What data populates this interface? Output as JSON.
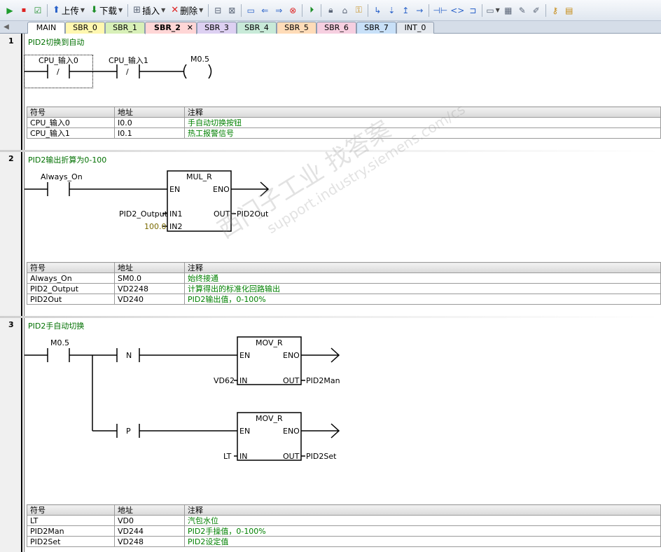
{
  "toolbar": {
    "upload_label": "上传",
    "download_label": "下载",
    "insert_label": "插入",
    "delete_label": "删除"
  },
  "tabs": [
    {
      "label": "MAIN",
      "color": "#ffffff",
      "active": false
    },
    {
      "label": "SBR_0",
      "color": "#fff7b0",
      "active": false
    },
    {
      "label": "SBR_1",
      "color": "#d8f0b8",
      "active": false
    },
    {
      "label": "SBR_2",
      "color": "#ffd6d6",
      "active": true
    },
    {
      "label": "SBR_3",
      "color": "#ddd0f2",
      "active": false
    },
    {
      "label": "SBR_4",
      "color": "#c8ead8",
      "active": false
    },
    {
      "label": "SBR_5",
      "color": "#ffdcb8",
      "active": false
    },
    {
      "label": "SBR_6",
      "color": "#f6cfe0",
      "active": false
    },
    {
      "label": "SBR_7",
      "color": "#c8e0f8",
      "active": false
    },
    {
      "label": "INT_0",
      "color": "#e4e8ee",
      "active": false
    }
  ],
  "networks": [
    {
      "number": "1",
      "title": "PID2切换到自动",
      "contacts": {
        "c1": "CPU_输入0",
        "c1_sym": "/",
        "c2": "CPU_输入1",
        "c2_sym": "/",
        "coil": "M0.5"
      },
      "symbols_header": {
        "symbol": "符号",
        "address": "地址",
        "comment": "注释"
      },
      "symbols": [
        {
          "symbol": "CPU_输入0",
          "address": "I0.0",
          "comment": "手自动切换按钮"
        },
        {
          "symbol": "CPU_输入1",
          "address": "I0.1",
          "comment": "热工报警信号"
        }
      ]
    },
    {
      "number": "2",
      "title": "PID2输出折算为0-100",
      "contacts": {
        "c1": "Always_On"
      },
      "box": {
        "name": "MUL_R",
        "en": "EN",
        "eno": "ENO",
        "in1": "IN1",
        "in2": "IN2",
        "out": "OUT",
        "in1_var": "PID2_Output",
        "in2_var": "100.0",
        "out_var": "PID2Out"
      },
      "symbols_header": {
        "symbol": "符号",
        "address": "地址",
        "comment": "注释"
      },
      "symbols": [
        {
          "symbol": "Always_On",
          "address": "SM0.0",
          "comment": "始终接通"
        },
        {
          "symbol": "PID2_Output",
          "address": "VD2248",
          "comment": "计算得出的标准化回路输出"
        },
        {
          "symbol": "PID2Out",
          "address": "VD240",
          "comment": "PID2输出值，0-100%"
        }
      ]
    },
    {
      "number": "3",
      "title": "PID2手自动切换",
      "contacts": {
        "c1": "M0.5",
        "n_label": "N",
        "p_label": "P"
      },
      "box1": {
        "name": "MOV_R",
        "en": "EN",
        "eno": "ENO",
        "in": "IN",
        "out": "OUT",
        "in_var": "VD62",
        "out_var": "PID2Man"
      },
      "box2": {
        "name": "MOV_R",
        "en": "EN",
        "eno": "ENO",
        "in": "IN",
        "out": "OUT",
        "in_var": "LT",
        "out_var": "PID2Set"
      },
      "symbols_header": {
        "symbol": "符号",
        "address": "地址",
        "comment": "注释"
      },
      "symbols": [
        {
          "symbol": "LT",
          "address": "VD0",
          "comment": "汽包水位"
        },
        {
          "symbol": "PID2Man",
          "address": "VD244",
          "comment": "PID2手操值，0-100%"
        },
        {
          "symbol": "PID2Set",
          "address": "VD248",
          "comment": "PID2设定值"
        }
      ]
    }
  ],
  "watermark": {
    "text": "西门子工业  找答案",
    "url": "support.industry.siemens.com/cs"
  }
}
